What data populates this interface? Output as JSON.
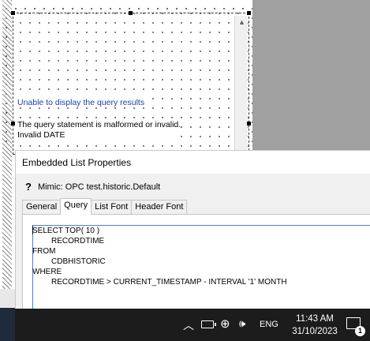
{
  "embedded_list": {
    "error_title": "Unable to display the query results",
    "error_line1": "The query statement is malformed or invalid.",
    "error_line2": "Invalid DATE"
  },
  "dialog": {
    "title": "Embedded List Properties",
    "mimic_label": "Mimic: OPC test.historic.Default",
    "tabs": [
      {
        "label": "General"
      },
      {
        "label": "Query",
        "active": true
      },
      {
        "label": "List Font"
      },
      {
        "label": "Header Font"
      }
    ],
    "query_lines": [
      "SELECT TOP( 10 )",
      "RECORDTIME",
      "FROM",
      "CDBHISTORIC",
      "WHERE",
      "RECORDTIME > CURRENT_TIMESTAMP - INTERVAL '1' MONTH"
    ]
  },
  "taskbar": {
    "language": "ENG",
    "time": "11:43 AM",
    "date": "31/10/2023",
    "notification_count": "1"
  },
  "icons": [
    "help-icon",
    "chevron-up-icon",
    "battery-icon",
    "globe-icon",
    "volume-icon",
    "notification-icon",
    "scroll-up-icon"
  ]
}
